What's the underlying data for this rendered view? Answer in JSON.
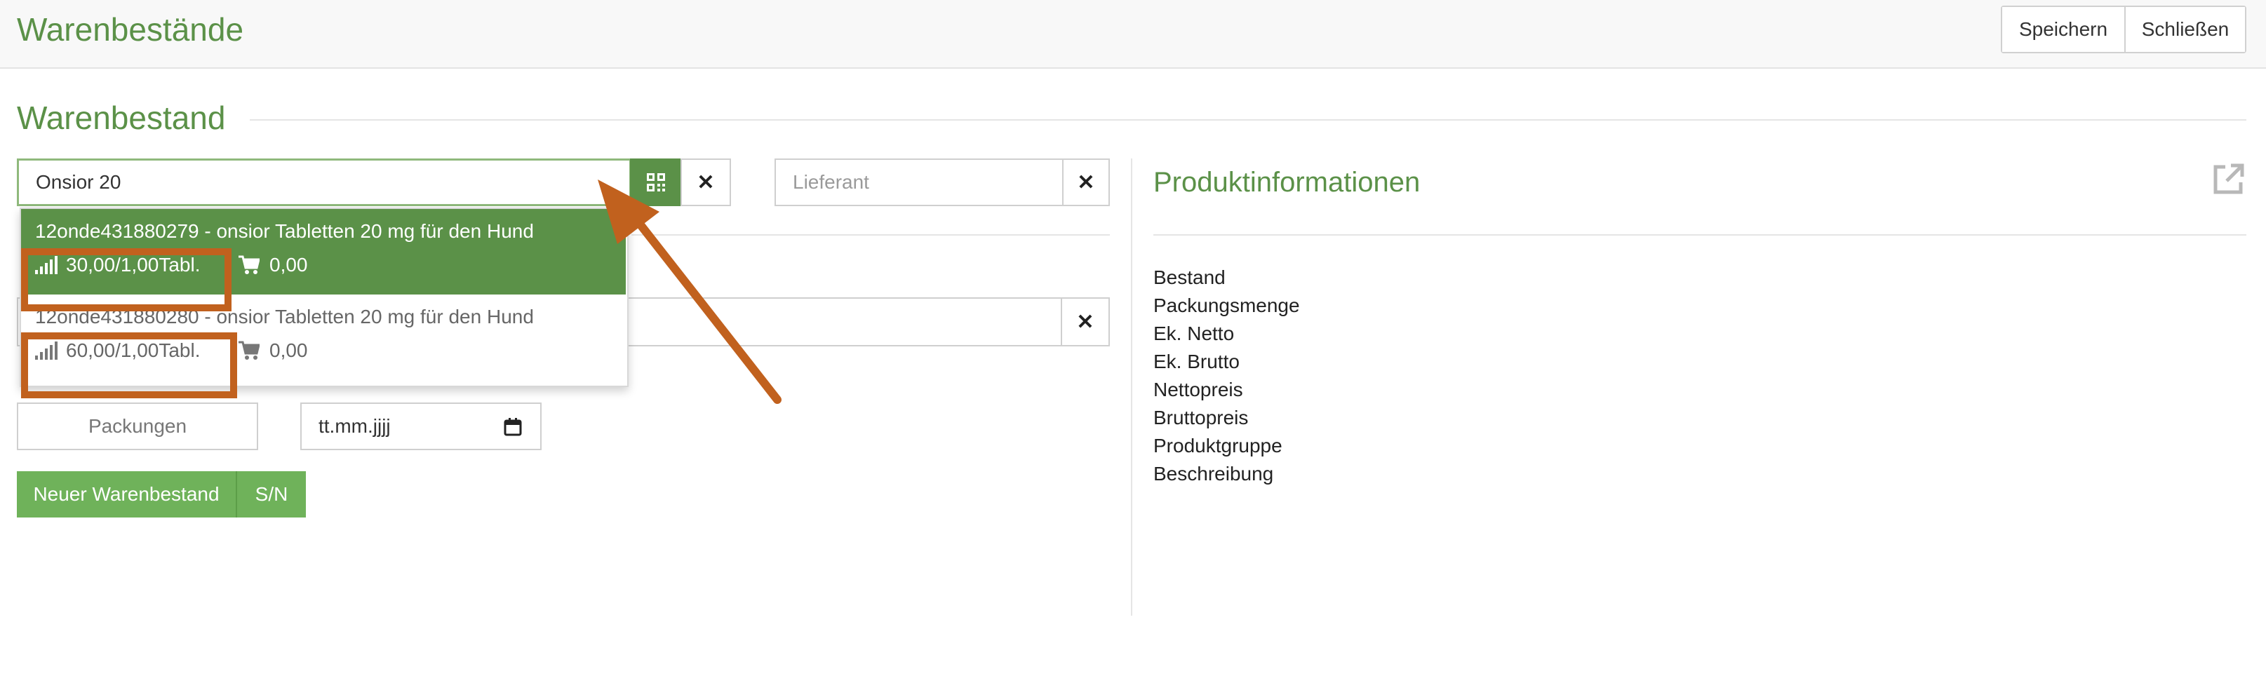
{
  "header": {
    "title": "Warenbestände",
    "save_label": "Speichern",
    "close_label": "Schließen"
  },
  "section": {
    "title": "Warenbestand"
  },
  "search": {
    "value": "Onsior 20",
    "supplier_placeholder": "Lieferant"
  },
  "dropdown": {
    "items": [
      {
        "name": "12onde431880279 - onsior Tabletten 20 mg für den Hund",
        "stock": "30,00/1,00Tabl.",
        "price": "0,00",
        "active": true
      },
      {
        "name": "12onde431880280 - onsior Tabletten 20 mg für den Hund",
        "stock": "60,00/1,00Tabl.",
        "price": "0,00",
        "active": false
      }
    ]
  },
  "form": {
    "packages_placeholder": "Packungen",
    "date_placeholder": "tt.mm.jjjj",
    "new_stock_label": "Neuer Warenbestand",
    "sn_label": "S/N"
  },
  "product_info": {
    "title": "Produktinformationen",
    "labels": [
      "Bestand",
      "Packungsmenge",
      "Ek. Netto",
      "Ek. Brutto",
      "Nettopreis",
      "Bruttopreis",
      "Produktgruppe",
      "Beschreibung"
    ]
  },
  "colors": {
    "brand_green": "#5b9148",
    "button_green": "#6fb25a",
    "annotation_orange": "#c1611e"
  },
  "icons": [
    "qr-code-icon",
    "close-icon",
    "signal-bars-icon",
    "shopping-cart-icon",
    "calendar-icon",
    "external-link-icon",
    "arrow-annotation"
  ]
}
